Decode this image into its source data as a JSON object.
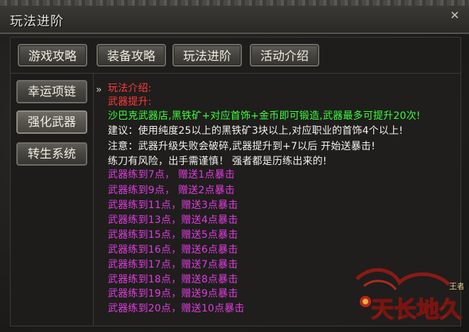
{
  "window": {
    "title": "玩法进阶",
    "close_label": "✕"
  },
  "tabs": [
    {
      "label": "游戏攻略"
    },
    {
      "label": "装备攻略"
    },
    {
      "label": "玩法进阶",
      "active": true
    },
    {
      "label": "活动介绍"
    }
  ],
  "sidebar": {
    "items": [
      {
        "label": "幸运项链"
      },
      {
        "label": "强化武器",
        "active": true
      },
      {
        "label": "转生系统"
      }
    ]
  },
  "content": {
    "arrow": "»",
    "heading": "玩法介绍:",
    "subheading": "武器提升:",
    "intro": "沙巴克武器店,黑铁矿+对应首饰+金币即可锻造,武器最多可提升20次!",
    "tips": [
      "建议：使用纯度25以上的黑铁矿3块以上,对应职业的首饰4个以上!",
      "注意：武器升级失败会破碎,武器提升到+7以后 开始送暴击!",
      "练刀有风险，出手需谨慎！ 强者都是历练出来的!"
    ],
    "rewards": [
      "武器练到7点，  赠送1点暴击",
      "武器练到9点，  赠送2点暴击",
      "武器练到11点，赠送3点暴击",
      "武器练到13点，赠送4点暴击",
      "武器练到15点，赠送5点暴击",
      "武器练到16点，赠送6点暴击",
      "武器练到17点，赠送7点暴击",
      "武器练到18点，赠送8点暴击",
      "武器练到19点，赠送9点暴击",
      "武器练到20点，赠送10点暴击"
    ]
  },
  "logo": {
    "text": "天长地久",
    "sub": "王者"
  },
  "colors": {
    "heading": "#ff3a3a",
    "intro": "#3aff3a",
    "tips": "#f4f2ec",
    "rewards": "#e23ae2"
  }
}
